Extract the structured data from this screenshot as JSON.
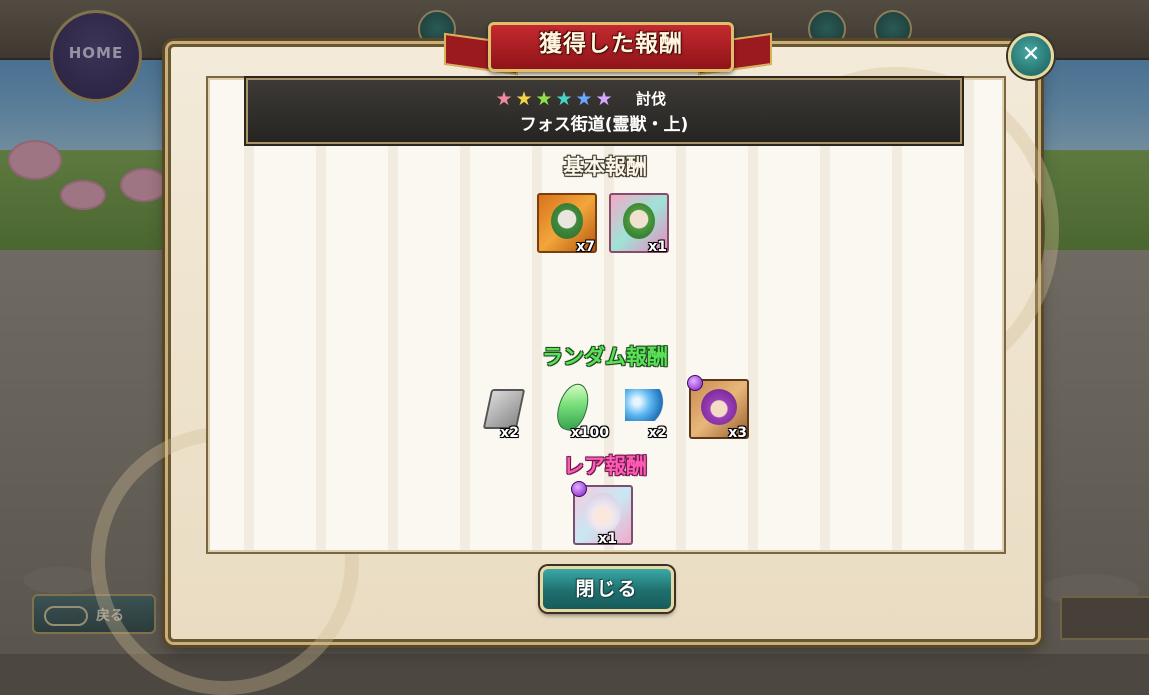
{
  "background": {
    "home_label": "HOME",
    "back_label": "戻る"
  },
  "dialog": {
    "title": "獲得した報酬",
    "close_icon": "close-icon",
    "header": {
      "stars": [
        {
          "glyph": "★",
          "color": "#f08aa0"
        },
        {
          "glyph": "★",
          "color": "#f2d34a"
        },
        {
          "glyph": "★",
          "color": "#8fe04a"
        },
        {
          "glyph": "★",
          "color": "#45d3c8"
        },
        {
          "glyph": "★",
          "color": "#6aa8ff"
        },
        {
          "glyph": "★",
          "color": "#d6a7ff"
        }
      ],
      "difficulty": "討伐",
      "stage_name": "フォス街道(霊獣・上)"
    },
    "sections": {
      "basic_title": "基本報酬",
      "random_title": "ランダム報酬",
      "rare_title": "レア報酬"
    },
    "basic_rewards": [
      {
        "icon": "green-hooded-unit-icon",
        "qty": "x7"
      },
      {
        "icon": "green-hooded-unit-rare-icon",
        "qty": "x1"
      }
    ],
    "random_rewards": [
      {
        "icon": "silver-book-icon",
        "qty": "x2"
      },
      {
        "icon": "green-crystal-icon",
        "qty": "x100"
      },
      {
        "icon": "blue-gem-cluster-icon",
        "qty": "x2"
      },
      {
        "icon": "purple-hat-unit-icon",
        "qty": "x3"
      }
    ],
    "rare_rewards": [
      {
        "icon": "white-haired-girl-unit-icon",
        "qty": "x1"
      }
    ],
    "close_button_label": "閉じる"
  },
  "colors": {
    "basic_title": "#fbf6e8",
    "random_title": "#5be05a",
    "rare_title": "#ff5bb5",
    "ribbon": "#9b1a1f",
    "button": "#1e6f6e"
  }
}
